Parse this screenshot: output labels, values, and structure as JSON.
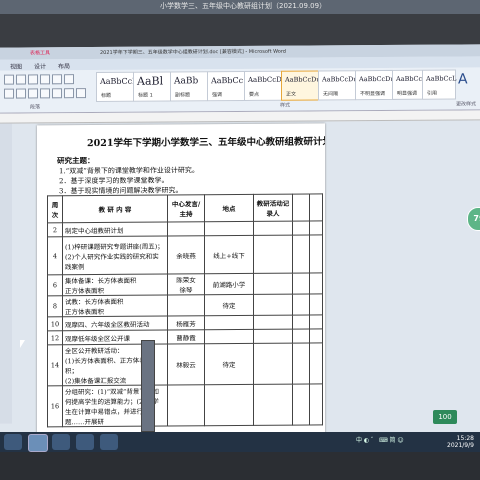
{
  "window": {
    "title": "小学数学三、五年级中心教研组计划（2021.09.09）",
    "doc_title_bar": "2021学年下学期三、五年级数学中心组教研计划.doc [兼容模式] - Microsoft Word",
    "context_tab": "表格工具"
  },
  "tabs": [
    "视图",
    "设计",
    "布局"
  ],
  "styles": [
    {
      "sample": "AaBbCcI",
      "name": "标题"
    },
    {
      "sample": "AaBl",
      "name": "标题 1"
    },
    {
      "sample": "AaBb",
      "name": "副标题"
    },
    {
      "sample": "AaBbCc",
      "name": "强调"
    },
    {
      "sample": "AaBbCcD",
      "name": "要点"
    },
    {
      "sample": "AaBbCcDu",
      "name": "正文"
    },
    {
      "sample": "AaBbCcDu",
      "name": "无间隔"
    },
    {
      "sample": "AaBbCcDu",
      "name": "不明显强调"
    },
    {
      "sample": "AaBbCcDu",
      "name": "明显强调"
    },
    {
      "sample": "AaBbCcL",
      "name": "引用"
    }
  ],
  "ribbon_groups": {
    "paragraph": "段落",
    "styles": "样式",
    "change_styles": "更改样式"
  },
  "document": {
    "title": "2021学年下学期小学数学三、五年级中心教研组教研计划",
    "heading": "研究主题：",
    "items": [
      "1.“双减”背景下的课堂教学和作业设计研究。",
      "2．基于深度学习的数学课堂教学。",
      "3．基于现实情境的问题解决教学研究。"
    ],
    "table": {
      "headers": [
        "周次",
        "教 研 内 容",
        "中心发言/主持",
        "地点",
        "教研活动记录人"
      ],
      "rows": [
        {
          "week": "2",
          "content": "制定中心组教研计划",
          "host": "",
          "place": "",
          "recorder": ""
        },
        {
          "week": "4",
          "content": "(1)梓研课题研究专题讲座(周五)；\n(2)个人研究作业实践的研究和实践案例",
          "host": "余晓燕",
          "place": "线上+线下",
          "recorder": ""
        },
        {
          "week": "6",
          "content": "集体备课：长方体表面积\n正方体表面积",
          "host": "陈荣女\n徐琴",
          "place": "前湖路小学",
          "recorder": ""
        },
        {
          "week": "8",
          "content": "试教：长方体表面积\n正方体表面积",
          "host": "",
          "place": "待定",
          "recorder": ""
        },
        {
          "week": "10",
          "content": "观摩四、六年级全区教研活动",
          "host": "杨雁芳",
          "place": "",
          "recorder": ""
        },
        {
          "week": "12",
          "content": "观摩低年级全区公开课",
          "host": "曹静霞",
          "place": "",
          "recorder": ""
        },
        {
          "week": "14",
          "content": "全区公开教研活动：\n(1)长方体表面积、正方体表面积；\n(2)集体备课汇报交流",
          "host": "林毅云",
          "place": "待定",
          "recorder": ""
        },
        {
          "week": "16",
          "content": "分组研究：(1)“双减”背景下，如何提高学生的运算能力；(2)提学生在计算中易错点，并进行习题……开展研",
          "host": "",
          "place": "",
          "recorder": ""
        }
      ]
    }
  },
  "overlay": {
    "badge": "79",
    "status_badge": "100"
  },
  "taskbar": {
    "tray_text": "中 ◐ ゛ ⌨ 简 ☺",
    "time": "15:28",
    "date": "2021/9/9"
  },
  "colors": {
    "ribbon": "#eaf0f7",
    "taskbar": "#233244",
    "selected_style": "#e7a73a"
  }
}
